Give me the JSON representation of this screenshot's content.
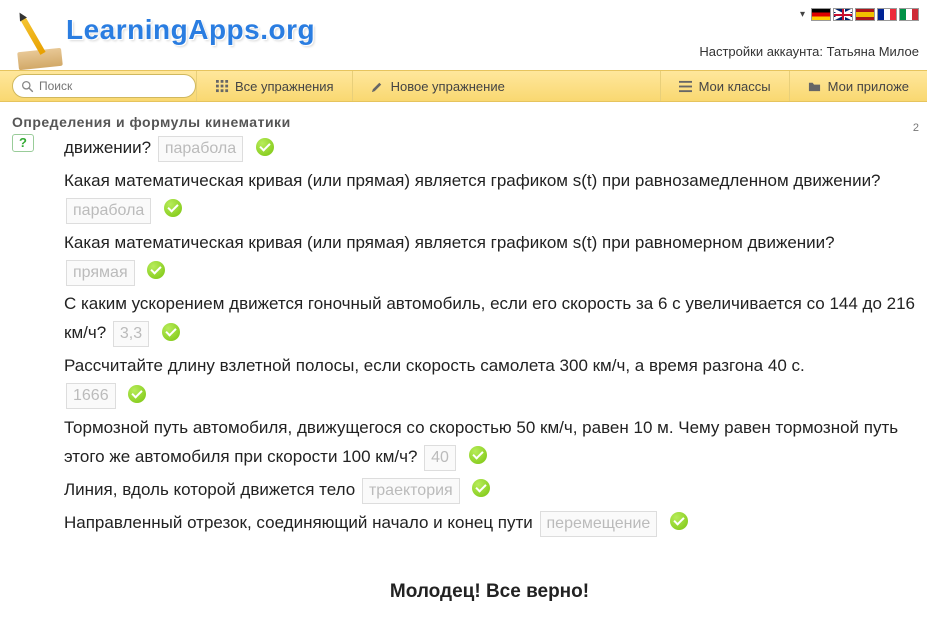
{
  "header": {
    "logo_text": "LearningApps.org",
    "account_label": "Настройки аккаунта: Татьяна Милое",
    "languages": [
      "de",
      "en",
      "es",
      "fr",
      "it"
    ]
  },
  "nav": {
    "search_placeholder": "Поиск",
    "all_exercises": "Все упражнения",
    "new_exercise": "Новое упражнение",
    "my_classes": "Мои классы",
    "my_apps": "Мои приложе"
  },
  "page": {
    "title": "Определения и формулы кинематики",
    "counter": "2"
  },
  "quiz": {
    "items": [
      {
        "q": "движении?",
        "a": "парабола"
      },
      {
        "q": "Какая математическая кривая (или прямая) является графиком s(t) при равнозамедленном движении?",
        "a": "парабола"
      },
      {
        "q": "Какая математическая кривая (или прямая) является графиком s(t) при равномерном движении?",
        "a": "прямая"
      },
      {
        "q": "С каким ускорением движется гоночный автомобиль, если его скорость за 6 с увеличивается со 144 до 216 км/ч?",
        "a": "3,3"
      },
      {
        "q": "Рассчитайте длину взлетной полосы, если скорость самолета 300 км/ч, а время разгона 40 с.",
        "a": "1666"
      },
      {
        "q": "Тормозной путь автомобиля, движущегося со скоростью 50 км/ч, равен 10 м. Чему равен тормозной путь этого же автомобиля при скорости 100 км/ч?",
        "a": "40"
      },
      {
        "q": "Линия, вдоль которой движется тело",
        "a": "траектория"
      },
      {
        "q": "Направленный отрезок, соединяющий начало и конец пути",
        "a": "перемещение"
      }
    ],
    "congrats": "Молодец! Все верно!"
  }
}
